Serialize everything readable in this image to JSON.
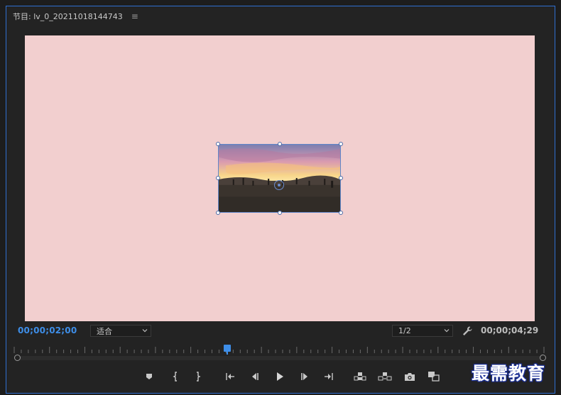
{
  "panel": {
    "title": "节目: lv_0_20211018144743",
    "menu_icon": "hamburger-menu-icon"
  },
  "viewer": {
    "canvas_color": "#f2cfcf",
    "clip_image": "sunset-beach-crowd-photo"
  },
  "controls": {
    "current_timecode": "00;00;02;00",
    "zoom_value": "适合",
    "resolution_value": "1/2",
    "settings_icon": "wrench-icon",
    "duration_timecode": "00;00;04;29"
  },
  "timeline": {
    "playhead_position": 0.4
  },
  "transport": {
    "buttons": [
      {
        "name": "add-marker",
        "icon": "marker-icon"
      },
      {
        "name": "mark-in",
        "icon": "mark-in-icon"
      },
      {
        "name": "mark-out",
        "icon": "mark-out-icon"
      },
      {
        "name": "go-to-in",
        "icon": "go-to-in-icon"
      },
      {
        "name": "step-back",
        "icon": "step-back-icon"
      },
      {
        "name": "play",
        "icon": "play-icon"
      },
      {
        "name": "step-forward",
        "icon": "step-forward-icon"
      },
      {
        "name": "go-to-out",
        "icon": "go-to-out-icon"
      },
      {
        "name": "lift",
        "icon": "lift-icon"
      },
      {
        "name": "extract",
        "icon": "extract-icon"
      },
      {
        "name": "export-frame",
        "icon": "camera-icon"
      },
      {
        "name": "compare-view",
        "icon": "compare-icon"
      }
    ]
  },
  "colors": {
    "accent": "#3e8ee8",
    "panel_border": "#2f6fd1",
    "background": "#232323"
  },
  "watermark": {
    "text": "最需教育"
  }
}
